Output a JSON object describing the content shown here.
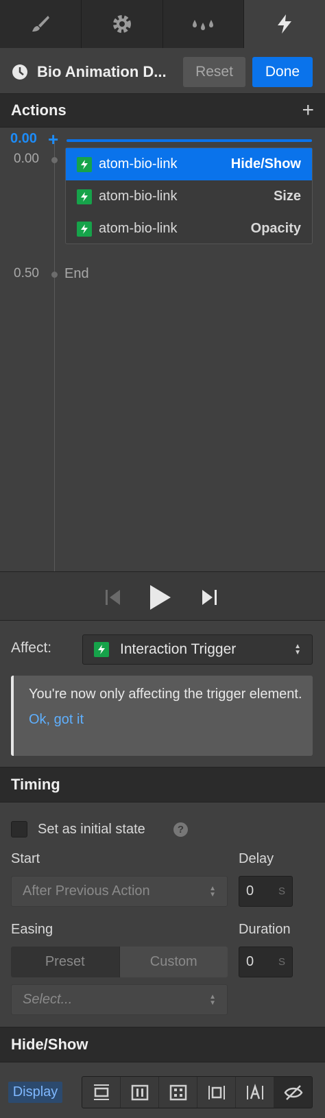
{
  "tabs": [
    {
      "icon": "brush-icon",
      "active": false
    },
    {
      "icon": "gear-icon",
      "active": false
    },
    {
      "icon": "drops-icon",
      "active": false
    },
    {
      "icon": "lightning-icon",
      "active": true
    }
  ],
  "header": {
    "title": "Bio Animation D...",
    "reset_label": "Reset",
    "done_label": "Done"
  },
  "actions": {
    "section_title": "Actions",
    "add_symbol": "+",
    "cursor_time": "0.00",
    "cursor_plus": "+",
    "groups": [
      {
        "time": "0.00"
      }
    ],
    "items": [
      {
        "element": "atom-bio-link",
        "type": "Hide/Show",
        "selected": true
      },
      {
        "element": "atom-bio-link",
        "type": "Size",
        "selected": false
      },
      {
        "element": "atom-bio-link",
        "type": "Opacity",
        "selected": false
      }
    ],
    "end_time": "0.50",
    "end_label": "End"
  },
  "affect": {
    "label": "Affect:",
    "value": "Interaction Trigger",
    "notice_text": "You're now only affecting the trigger element.",
    "notice_link": "Ok, got it"
  },
  "timing": {
    "section_title": "Timing",
    "initial_state_label": "Set as initial state",
    "help_symbol": "?",
    "start_label": "Start",
    "start_value": "After Previous Action",
    "delay_label": "Delay",
    "delay_value": "0",
    "delay_unit": "S",
    "easing_label": "Easing",
    "preset_label": "Preset",
    "custom_label": "Custom",
    "easing_placeholder": "Select...",
    "duration_label": "Duration",
    "duration_value": "0",
    "duration_unit": "S"
  },
  "hideshow": {
    "section_title": "Hide/Show",
    "display_label": "Display",
    "display_options": [
      "block-icon",
      "flex-icon",
      "grid-icon",
      "inline-block-icon",
      "inline-icon",
      "none-icon"
    ]
  },
  "colors": {
    "accent": "#0a73eb",
    "bolt": "#16a34a",
    "panel": "#404040",
    "dark": "#2b2b2b"
  }
}
